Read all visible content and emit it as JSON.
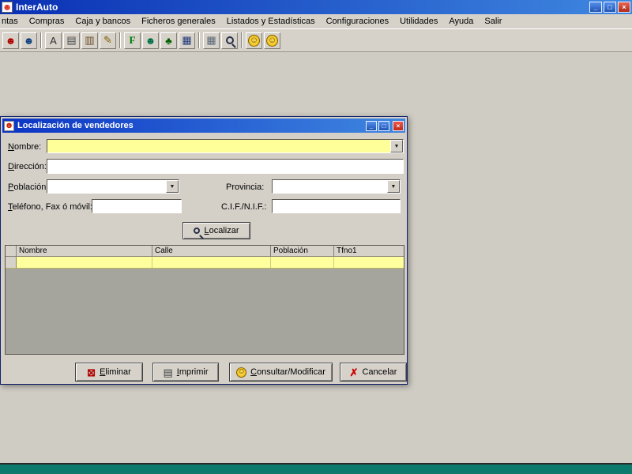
{
  "window": {
    "title": "InterAuto",
    "controls": {
      "minimize": "_",
      "maximize": "□",
      "close": "×"
    }
  },
  "menubar": {
    "items": [
      "ntas",
      "Compras",
      "Caja y bancos",
      "Ficheros generales",
      "Listados y Estadísticas",
      "Configuraciones",
      "Utilidades",
      "Ayuda",
      "Salir"
    ]
  },
  "toolbar": {
    "icons": [
      {
        "name": "vendor-icon",
        "glyph": "☻"
      },
      {
        "name": "customer-icon",
        "glyph": "☻"
      },
      {
        "name": "document-a-icon",
        "glyph": "A"
      },
      {
        "name": "printer-icon",
        "glyph": "▤"
      },
      {
        "name": "form-icon",
        "glyph": "▥"
      },
      {
        "name": "edit-icon",
        "glyph": "✎"
      },
      {
        "name": "f-key-icon",
        "glyph": "F"
      },
      {
        "name": "people-icon",
        "glyph": "☻"
      },
      {
        "name": "tree-icon",
        "glyph": "♣"
      },
      {
        "name": "calculator-icon",
        "glyph": "▦"
      },
      {
        "name": "grid-icon",
        "glyph": "▦"
      },
      {
        "name": "search-document-icon",
        "glyph": ""
      },
      {
        "name": "smiley-icon",
        "glyph": "☺"
      },
      {
        "name": "smiley-search-icon",
        "glyph": "☺"
      }
    ]
  },
  "icons": {
    "app": "☻",
    "dialog": "☻",
    "dropdown": "▼",
    "eliminar": "⊠",
    "imprimir": "▤",
    "consultar": "☺",
    "cancelar": "✗"
  },
  "dialog": {
    "title": "Localización de vendedores",
    "controls": {
      "minimize": "_",
      "maximize": "□",
      "close": "×"
    },
    "fields": {
      "nombre": {
        "label": "Nombre:",
        "value": ""
      },
      "direccion": {
        "label": "Dirección:",
        "value": ""
      },
      "poblacion": {
        "label": "Población:",
        "value": ""
      },
      "provincia": {
        "label": "Provincia:",
        "value": ""
      },
      "telefono": {
        "label": "Teléfono, Fax ó móvil:",
        "value": ""
      },
      "cif": {
        "label": "C.I.F./N.I.F.:",
        "value": ""
      }
    },
    "localizar_button": "Localizar",
    "table": {
      "columns": [
        "",
        "Nombre",
        "Calle",
        "Población",
        "Tfno1"
      ],
      "selected_row": [
        "",
        "",
        "",
        ""
      ]
    },
    "buttons": {
      "eliminar": "Eliminar",
      "imprimir": "Imprimir",
      "consultar_modificar": "Consultar/Modificar",
      "cancelar": "Cancelar"
    }
  },
  "colors": {
    "titlebar_start": "#0a30b4",
    "titlebar_end": "#3f87e0",
    "chrome": "#d4d0c8",
    "field_yellow": "#ffff99",
    "selected_row_yellow": "#ffff9e",
    "grid_gray": "#a5a59e",
    "close_red": "#c02818",
    "bottom_teal": "#0d7a6e"
  }
}
